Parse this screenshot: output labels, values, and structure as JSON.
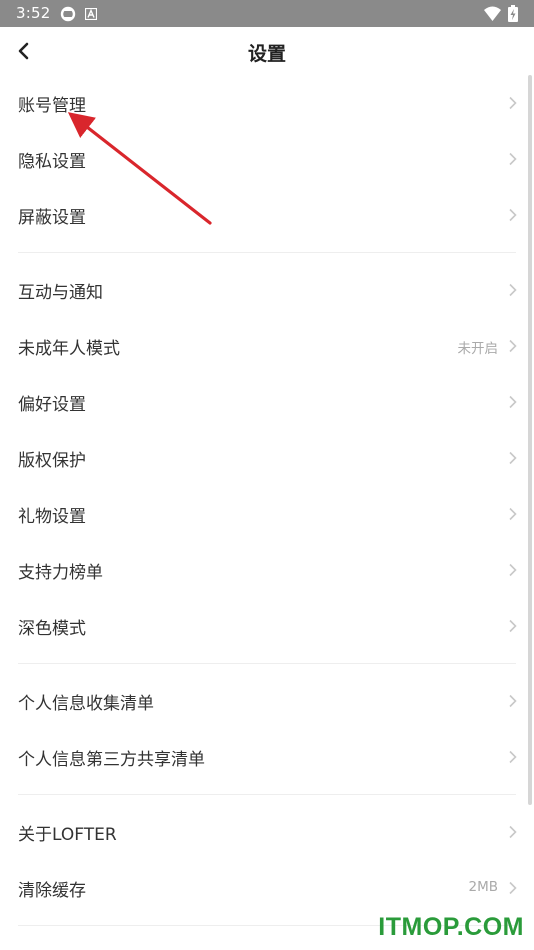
{
  "status_bar": {
    "time": "3:52",
    "icons": [
      "sync-icon",
      "app-a-icon",
      "wifi-icon",
      "battery-charging-icon"
    ]
  },
  "nav": {
    "title": "设置",
    "back_icon": "chevron-left-icon"
  },
  "sections": [
    [
      {
        "label": "账号管理",
        "value": ""
      },
      {
        "label": "隐私设置",
        "value": ""
      },
      {
        "label": "屏蔽设置",
        "value": ""
      }
    ],
    [
      {
        "label": "互动与通知",
        "value": ""
      },
      {
        "label": "未成年人模式",
        "value": "未开启"
      },
      {
        "label": "偏好设置",
        "value": ""
      },
      {
        "label": "版权保护",
        "value": ""
      },
      {
        "label": "礼物设置",
        "value": ""
      },
      {
        "label": "支持力榜单",
        "value": ""
      },
      {
        "label": "深色模式",
        "value": ""
      }
    ],
    [
      {
        "label": "个人信息收集清单",
        "value": ""
      },
      {
        "label": "个人信息第三方共享清单",
        "value": ""
      }
    ],
    [
      {
        "label": "关于LOFTER",
        "value": ""
      },
      {
        "label": "清除缓存",
        "value": "2MB"
      }
    ]
  ],
  "colors": {
    "status_bar": "#8a8a8a",
    "label": "#333333",
    "value": "#aaaaaa",
    "chevron": "#c8c8c8",
    "annotation_arrow": "#d9262c",
    "watermark": "#2a9b3a"
  },
  "watermark": "ITMOP.COM"
}
